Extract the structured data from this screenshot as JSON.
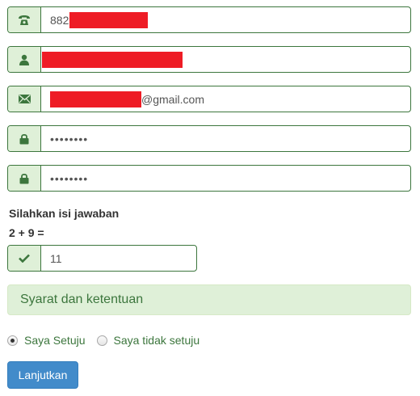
{
  "form": {
    "phone": {
      "icon": "phone-icon",
      "value_prefix": "882"
    },
    "name": {
      "icon": "user-icon",
      "value": ""
    },
    "email": {
      "icon": "envelope-icon",
      "value_suffix": "@gmail.com"
    },
    "password": {
      "icon": "lock-icon",
      "value": "••••••••"
    },
    "password_confirm": {
      "icon": "lock-icon",
      "value": "••••••••"
    },
    "captcha": {
      "label": "Silahkan isi jawaban",
      "question": "2 + 9 =",
      "icon": "check-icon",
      "value": "11"
    },
    "terms": {
      "label": "Syarat dan ketentuan"
    },
    "agreement": {
      "options": [
        {
          "label": "Saya Setuju",
          "checked": true
        },
        {
          "label": "Saya tidak setuju",
          "checked": false
        }
      ]
    },
    "submit_label": "Lanjutkan"
  },
  "colors": {
    "field_border": "#3c763d",
    "addon_bg": "#dff0d8",
    "icon": "#3c763d",
    "redaction": "#ee1c25",
    "button": "#428bca"
  }
}
